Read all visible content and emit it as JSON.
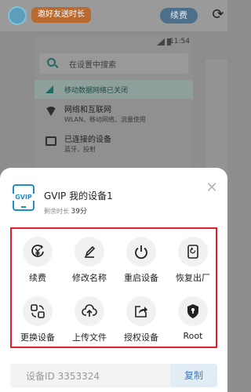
{
  "topbar": {
    "share_label": "邀好友送时长",
    "renew_label": "续费",
    "refresh_icon": "refresh-icon"
  },
  "phone": {
    "time": "11:54",
    "search_placeholder": "在设置中搜索",
    "notice": "移动数据网络已关闭",
    "rows": [
      {
        "title": "网络和互联网",
        "subtitle": "WLAN、移动网络、流量使用",
        "icon": "wifi-icon"
      },
      {
        "title": "已连接的设备",
        "subtitle": "蓝牙、投射",
        "icon": "devices-icon"
      }
    ]
  },
  "sheet": {
    "badge_text": "GVIP",
    "device_name": "GVIP 我的设备1",
    "remaining_prefix": "剩余时长",
    "remaining_value": "39分",
    "actions": [
      {
        "label": "续费",
        "icon": "renew-icon"
      },
      {
        "label": "修改名称",
        "icon": "edit-icon"
      },
      {
        "label": "重启设备",
        "icon": "power-icon"
      },
      {
        "label": "恢复出厂",
        "icon": "factory-reset-icon"
      },
      {
        "label": "更换设备",
        "icon": "swap-device-icon"
      },
      {
        "label": "上传文件",
        "icon": "upload-icon"
      },
      {
        "label": "授权设备",
        "icon": "authorize-icon"
      },
      {
        "label": "Root",
        "icon": "root-shield-icon"
      }
    ],
    "device_id_label": "设备ID 3353324",
    "copy_label": "复制"
  },
  "colors": {
    "accent_blue": "#1f8fc8",
    "highlight_red": "#e0202a",
    "copy_blue": "#3d7ec0"
  }
}
